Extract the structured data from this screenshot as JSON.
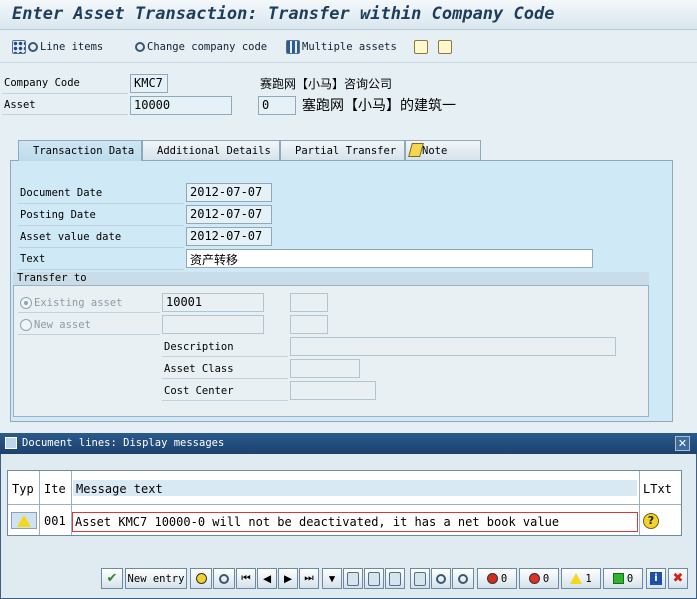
{
  "window": {
    "title": "Enter Asset Transaction: Transfer within Company Code"
  },
  "toolbar": {
    "line_items": "Line items",
    "change_company_code": "Change company code",
    "multiple_assets": "Multiple assets"
  },
  "header": {
    "company_code_label": "Company Code",
    "company_code_value": "KMC7",
    "company_name": "赛跑网【小马】咨询公司",
    "asset_label": "Asset",
    "asset_value": "10000",
    "sub_number": "0",
    "asset_description": "塞跑网【小马】的建筑一"
  },
  "tabs": [
    {
      "label": "Transaction Data",
      "active": true
    },
    {
      "label": "Additional Details"
    },
    {
      "label": "Partial Transfer"
    },
    {
      "label": "Note"
    }
  ],
  "transaction": {
    "document_date_label": "Document Date",
    "document_date": "2012-07-07",
    "posting_date_label": "Posting Date",
    "posting_date": "2012-07-07",
    "asset_value_date_label": "Asset value date",
    "asset_value_date": "2012-07-07",
    "text_label": "Text",
    "text_value": "资产转移"
  },
  "transfer_to": {
    "title": "Transfer to",
    "existing_asset_label": "Existing asset",
    "existing_asset_value": "10001",
    "new_asset_label": "New asset",
    "description_label": "Description",
    "asset_class_label": "Asset Class",
    "cost_center_label": "Cost Center"
  },
  "dialog": {
    "title": "Document lines: Display messages",
    "columns": [
      "Typ",
      "Ite",
      "Message text",
      "LTxt"
    ],
    "rows": [
      {
        "type": "warning",
        "item": "001",
        "message": "Asset KMC7 10000-0 will not be deactivated, it has a net book value"
      }
    ],
    "new_entry_label": "New entry",
    "counts": {
      "stop": "0",
      "error": "0",
      "warning": "1",
      "success": "0"
    }
  },
  "colors": {
    "panel": "#d0e9f6",
    "title_bar": "#1d416d",
    "error_border": "#d23c3c",
    "warning": "#f3d91e"
  }
}
